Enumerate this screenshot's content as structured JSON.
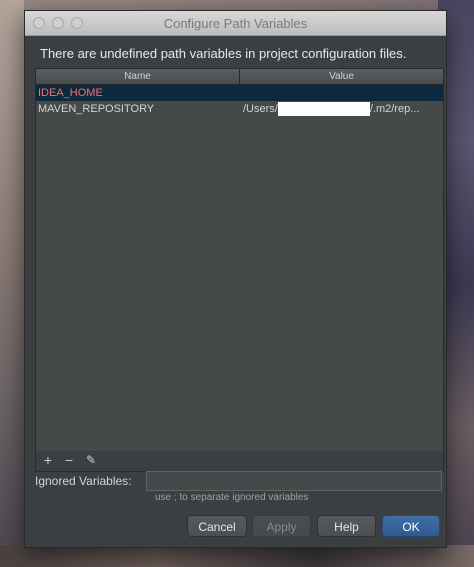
{
  "window": {
    "title": "Configure Path Variables"
  },
  "message": "There are undefined path variables in project configuration files.",
  "table": {
    "columns": [
      "Name",
      "Value"
    ],
    "rows": [
      {
        "name": "IDEA_HOME",
        "value_prefix": "",
        "value_suffix": ""
      },
      {
        "name": "MAVEN_REPOSITORY",
        "value_prefix": "/Users/",
        "value_suffix": "/.m2/rep..."
      }
    ]
  },
  "toolbar": {
    "add": "+",
    "remove": "−",
    "edit": "✎"
  },
  "ignored": {
    "label": "Ignored Variables:",
    "value": "",
    "hint": "use ; to separate ignored variables"
  },
  "buttons": {
    "cancel": "Cancel",
    "apply": "Apply",
    "help": "Help",
    "ok": "OK"
  }
}
